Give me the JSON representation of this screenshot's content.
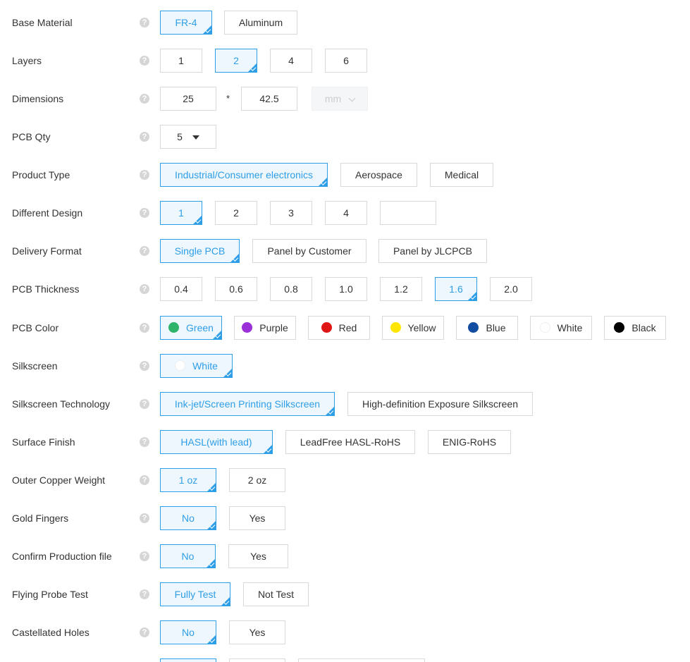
{
  "help_icon": "?",
  "rows": {
    "base_material": {
      "label": "Base Material",
      "options": [
        "FR-4",
        "Aluminum"
      ]
    },
    "layers": {
      "label": "Layers",
      "options": [
        "1",
        "2",
        "4",
        "6"
      ]
    },
    "dimensions": {
      "label": "Dimensions",
      "width": "25",
      "times": "*",
      "height": "42.5",
      "unit": "mm"
    },
    "pcb_qty": {
      "label": "PCB Qty",
      "value": "5"
    },
    "product_type": {
      "label": "Product Type",
      "options": [
        "Industrial/Consumer electronics",
        "Aerospace",
        "Medical"
      ]
    },
    "different_design": {
      "label": "Different Design",
      "options": [
        "1",
        "2",
        "3",
        "4",
        ""
      ]
    },
    "delivery_format": {
      "label": "Delivery Format",
      "options": [
        "Single PCB",
        "Panel by Customer",
        "Panel by JLCPCB"
      ]
    },
    "pcb_thickness": {
      "label": "PCB Thickness",
      "options": [
        "0.4",
        "0.6",
        "0.8",
        "1.0",
        "1.2",
        "1.6",
        "2.0"
      ]
    },
    "pcb_color": {
      "label": "PCB Color",
      "options": [
        "Green",
        "Purple",
        "Red",
        "Yellow",
        "Blue",
        "White",
        "Black"
      ]
    },
    "silkscreen": {
      "label": "Silkscreen",
      "options": [
        "White"
      ]
    },
    "silkscreen_technology": {
      "label": "Silkscreen Technology",
      "options": [
        "Ink-jet/Screen Printing Silkscreen",
        "High-definition Exposure Silkscreen"
      ]
    },
    "surface_finish": {
      "label": "Surface Finish",
      "options": [
        "HASL(with lead)",
        "LeadFree HASL-RoHS",
        "ENIG-RoHS"
      ]
    },
    "outer_copper_weight": {
      "label": "Outer Copper Weight",
      "options": [
        "1 oz",
        "2 oz"
      ]
    },
    "gold_fingers": {
      "label": "Gold Fingers",
      "options": [
        "No",
        "Yes"
      ]
    },
    "confirm_production_file": {
      "label": "Confirm Production file",
      "options": [
        "No",
        "Yes"
      ]
    },
    "flying_probe_test": {
      "label": "Flying Probe Test",
      "options": [
        "Fully Test",
        "Not Test"
      ]
    },
    "castellated_holes": {
      "label": "Castellated Holes",
      "options": [
        "No",
        "Yes"
      ]
    }
  },
  "colors": {
    "accent": "#2e9ee6",
    "green": "#2db36a",
    "purple": "#9b30d9",
    "red": "#e01515",
    "yellow": "#ffe600",
    "blue": "#124da1",
    "white": "#ffffff",
    "black": "#000000"
  }
}
